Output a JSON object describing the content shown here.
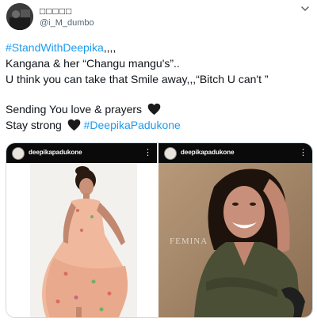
{
  "user": {
    "display_name": "□□□□□",
    "handle": "@i_M_dumbo"
  },
  "tweet": {
    "line1_hashtag": "#StandWithDeepika",
    "line1_suffix": ",,,,",
    "line2": "Kangana & her “Changu mangu's”..",
    "line3": "U think you can take that Smile away,,,“Bitch U can't ”",
    "line4": "Sending You love & prayers",
    "line5_prefix": "Stay strong",
    "line5_hashtag": "#DeepikaPadukone"
  },
  "media": {
    "left": {
      "account": "deepikapadukone",
      "menu": "⋮"
    },
    "right": {
      "account": "deepikapadukone",
      "menu": "⋮",
      "magazine_text": "FEMINA"
    }
  },
  "colors": {
    "link": "#1d9bf0",
    "text": "#0f1419",
    "secondary": "#536471"
  }
}
